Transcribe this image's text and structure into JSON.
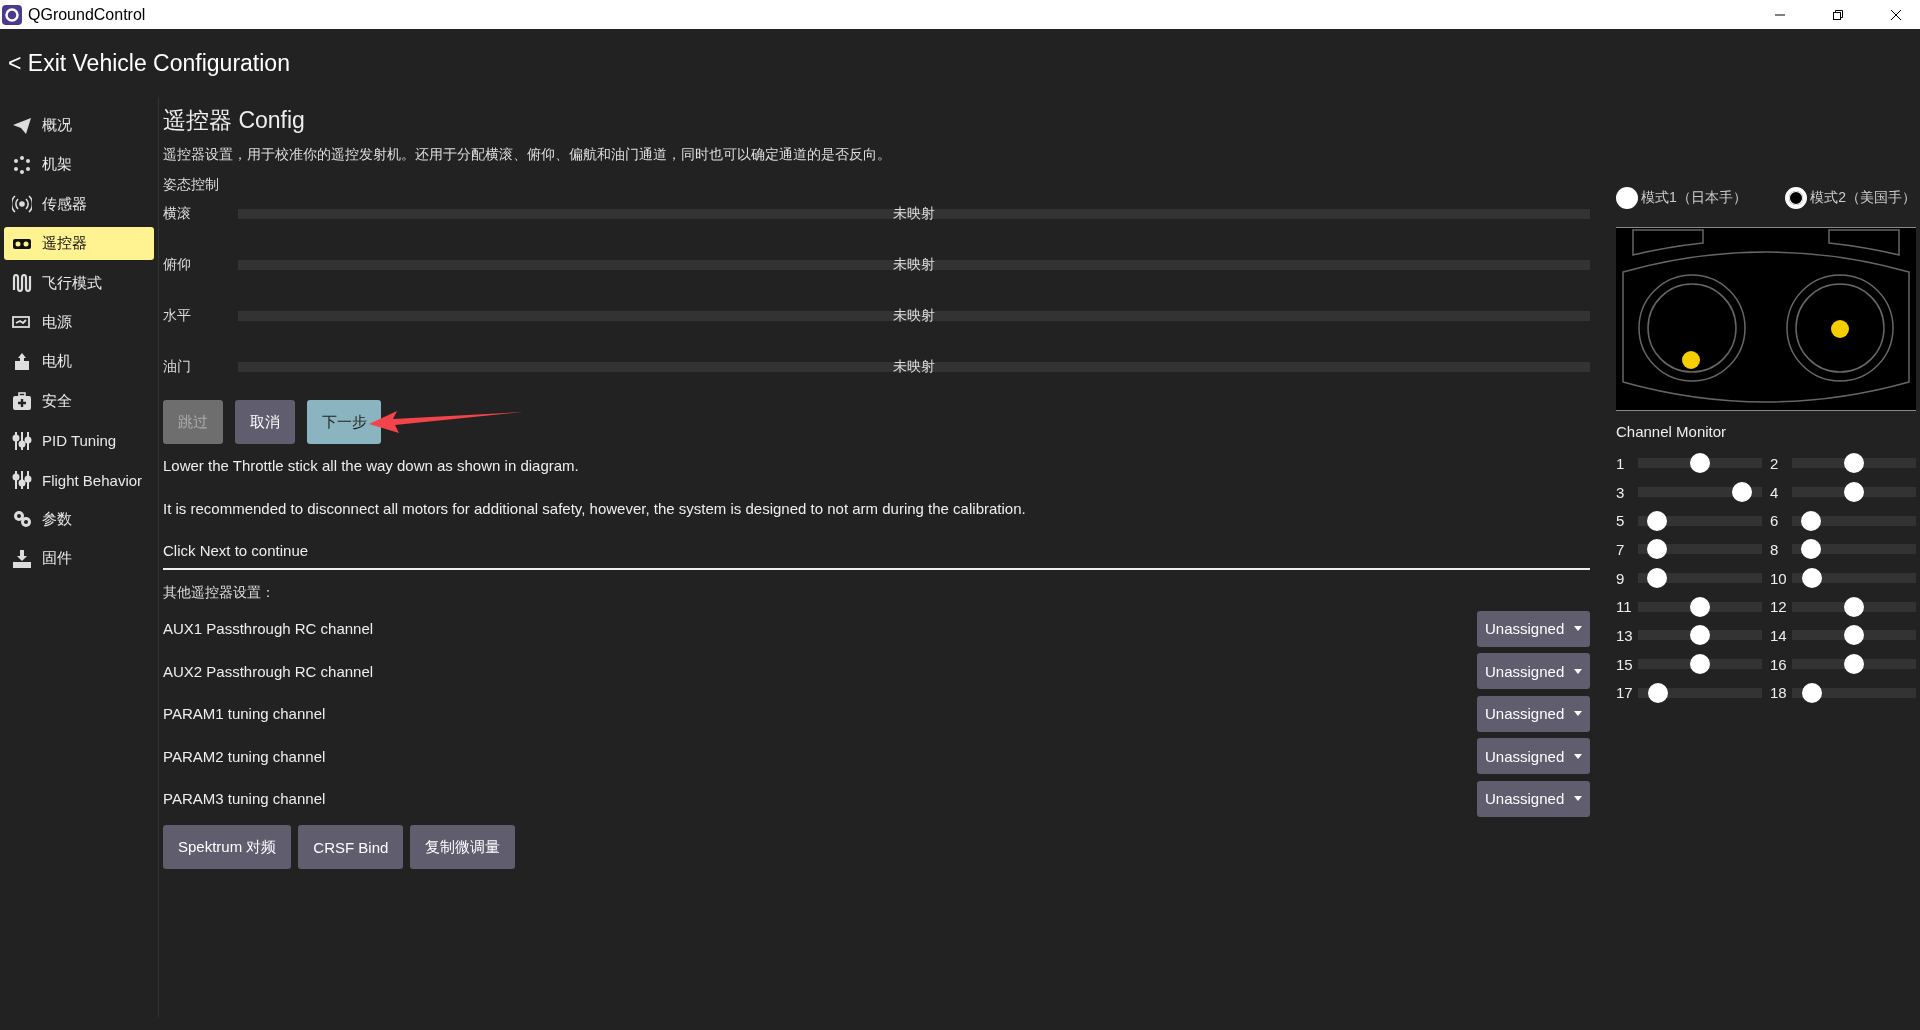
{
  "window": {
    "title": "QGroundControl"
  },
  "header": {
    "back_link": "< Exit Vehicle Configuration"
  },
  "sidebar": {
    "items": [
      {
        "label": "概况",
        "selected": false
      },
      {
        "label": "机架",
        "selected": false
      },
      {
        "label": "传感器",
        "selected": false
      },
      {
        "label": "遥控器",
        "selected": true
      },
      {
        "label": "飞行模式",
        "selected": false
      },
      {
        "label": "电源",
        "selected": false
      },
      {
        "label": "电机",
        "selected": false
      },
      {
        "label": "安全",
        "selected": false
      },
      {
        "label": "PID Tuning",
        "selected": false
      },
      {
        "label": "Flight Behavior",
        "selected": false
      },
      {
        "label": "参数",
        "selected": false
      },
      {
        "label": "固件",
        "selected": false
      }
    ]
  },
  "page": {
    "title": "遥控器 Config",
    "description": "遥控器设置，用于校准你的遥控发射机。还用于分配横滚、俯仰、偏航和油门通道，同时也可以确定通道的是否反向。",
    "attitude": {
      "heading": "姿态控制",
      "channels": [
        {
          "name": "横滚",
          "reading": "未映射"
        },
        {
          "name": "俯仰",
          "reading": "未映射"
        },
        {
          "name": "水平",
          "reading": "未映射"
        },
        {
          "name": "油门",
          "reading": "未映射"
        }
      ]
    },
    "wizard_buttons": [
      {
        "label": "跳过",
        "kind": "plain",
        "disabled": true
      },
      {
        "label": "取消",
        "kind": "plain",
        "disabled": false
      },
      {
        "label": "下一步",
        "kind": "primary",
        "disabled": false
      }
    ],
    "instructions": [
      "Lower the Throttle stick all the way down as shown in diagram.",
      "It is recommended to disconnect all motors for additional safety, however, the system is designed to not arm during the calibration.",
      "Click Next to continue"
    ],
    "other": {
      "heading": "其他遥控器设置：",
      "rows": [
        {
          "label": "AUX1 Passthrough RC channel",
          "value": "Unassigned"
        },
        {
          "label": "AUX2 Passthrough RC channel",
          "value": "Unassigned"
        },
        {
          "label": "PARAM1 tuning channel",
          "value": "Unassigned"
        },
        {
          "label": "PARAM2 tuning channel",
          "value": "Unassigned"
        },
        {
          "label": "PARAM3 tuning channel",
          "value": "Unassigned"
        }
      ]
    },
    "bottom_buttons": [
      "Spektrum 对频",
      "CRSF Bind",
      "复制微调量"
    ]
  },
  "right": {
    "modes": [
      {
        "label": "模式1（日本手）",
        "selected": false
      },
      {
        "label": "模式2（美国手）",
        "selected": true
      }
    ],
    "channel_monitor": {
      "title": "Channel Monitor",
      "channels": [
        {
          "number": "1",
          "level": 0.5
        },
        {
          "number": "2",
          "level": 0.5
        },
        {
          "number": "3",
          "level": 0.9
        },
        {
          "number": "4",
          "level": 0.5
        },
        {
          "number": "5",
          "level": 0.09
        },
        {
          "number": "6",
          "level": 0.09
        },
        {
          "number": "7",
          "level": 0.09
        },
        {
          "number": "8",
          "level": 0.09
        },
        {
          "number": "9",
          "level": 0.09
        },
        {
          "number": "10",
          "level": 0.1
        },
        {
          "number": "11",
          "level": 0.5
        },
        {
          "number": "12",
          "level": 0.5
        },
        {
          "number": "13",
          "level": 0.5
        },
        {
          "number": "14",
          "level": 0.5
        },
        {
          "number": "15",
          "level": 0.5
        },
        {
          "number": "16",
          "level": 0.5
        },
        {
          "number": "17",
          "level": 0.1
        },
        {
          "number": "18",
          "level": 0.1
        }
      ]
    }
  }
}
